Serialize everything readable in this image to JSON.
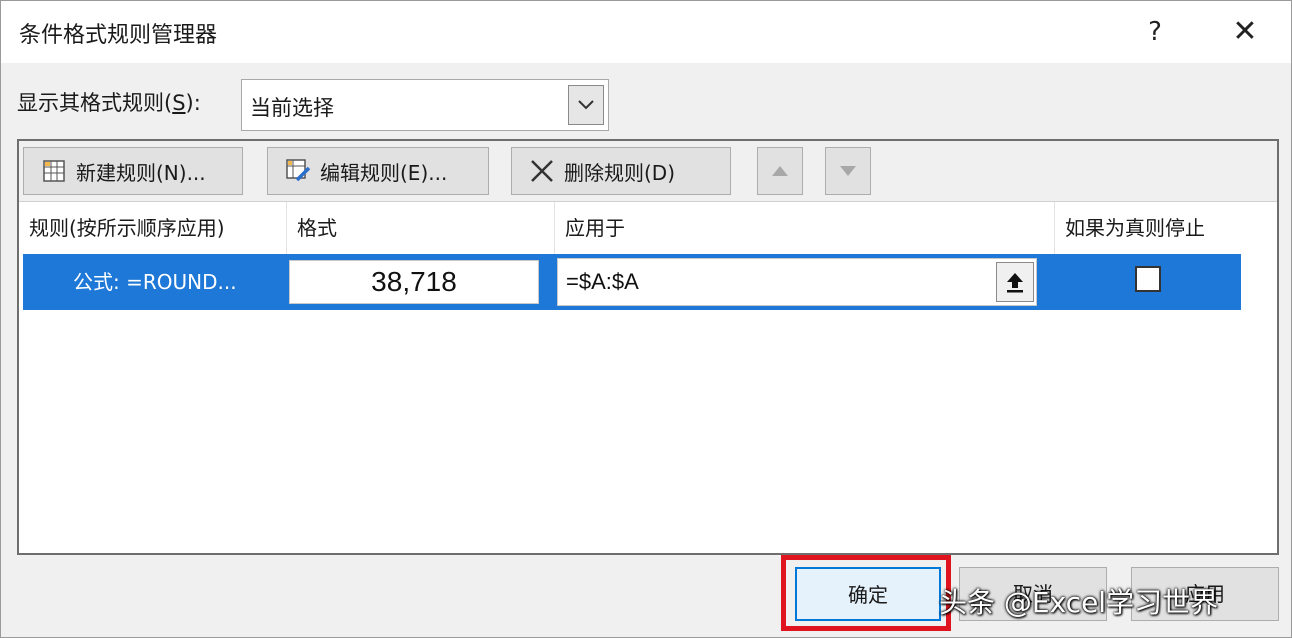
{
  "window": {
    "title": "条件格式规则管理器",
    "help": "?",
    "close": "✕"
  },
  "show_rules": {
    "label": "显示其格式规则(",
    "accesskey": "S",
    "label_end": "):",
    "selected": "当前选择"
  },
  "toolbar": {
    "new_rule": "新建规则(N)...",
    "edit_rule": "编辑规则(E)...",
    "delete_rule": "删除规则(D)"
  },
  "table": {
    "headers": [
      "规则(按所示顺序应用)",
      "格式",
      "应用于",
      "如果为真则停止"
    ],
    "rows": [
      {
        "rule": "公式: =ROUND...",
        "format_preview": "38,718",
        "applies_to": "=$A:$A",
        "stop_if_true": false
      }
    ]
  },
  "footer": {
    "ok": "确定",
    "cancel": "取消",
    "apply": "应用"
  },
  "watermark": "头条 @Excel学习世界",
  "colors": {
    "selection": "#1e78d7",
    "highlight_outline": "#e0141e"
  }
}
